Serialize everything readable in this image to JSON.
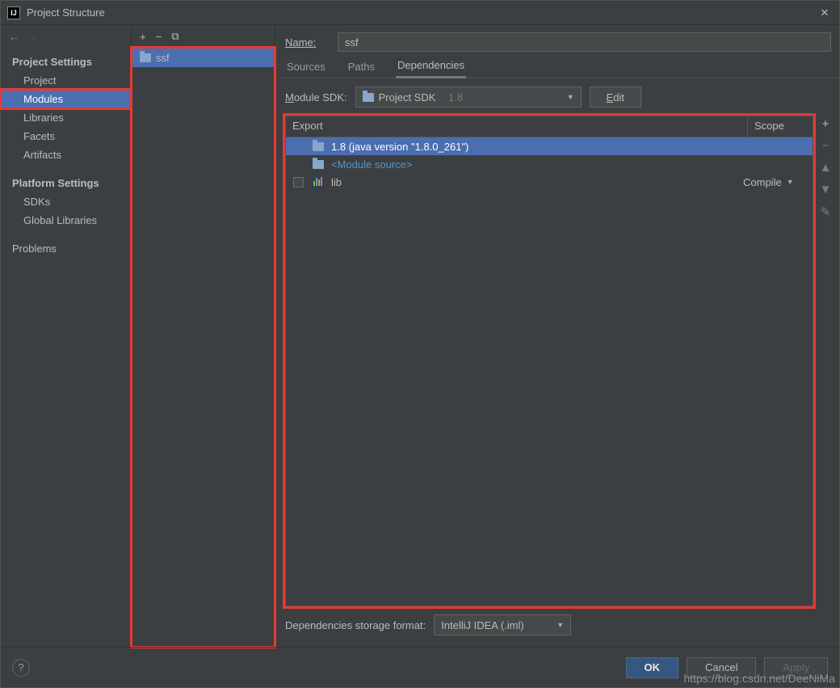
{
  "window": {
    "title": "Project Structure"
  },
  "sidebar": {
    "sections": [
      {
        "title": "Project Settings",
        "items": [
          "Project",
          "Modules",
          "Libraries",
          "Facets",
          "Artifacts"
        ],
        "selectedIndex": 1
      },
      {
        "title": "Platform Settings",
        "items": [
          "SDKs",
          "Global Libraries"
        ]
      },
      {
        "title": "",
        "items": [
          "Problems"
        ]
      }
    ]
  },
  "modulesList": {
    "items": [
      {
        "name": "ssf"
      }
    ],
    "selectedIndex": 0
  },
  "details": {
    "nameLabel": "Name:",
    "nameValue": "ssf",
    "tabs": [
      "Sources",
      "Paths",
      "Dependencies"
    ],
    "activeTab": 2,
    "sdkLabelPrefix": "M",
    "sdkLabelRest": "odule SDK:",
    "sdkCombo": {
      "text": "Project SDK",
      "suffix": "1.8"
    },
    "editPrefix": "E",
    "editRest": "dit",
    "depHeaders": {
      "export": "Export",
      "scope": "Scope"
    },
    "depRows": [
      {
        "icon": "folder",
        "text": "1.8 (java version \"1.8.0_261\")",
        "checkable": false,
        "scope": "",
        "selected": true
      },
      {
        "icon": "folder",
        "text": "<Module source>",
        "checkable": false,
        "link": true
      },
      {
        "icon": "lib",
        "text": "lib",
        "checkable": true,
        "scope": "Compile"
      }
    ],
    "formatLabel": "Dependencies storage format:",
    "formatValue": "IntelliJ IDEA (.iml)"
  },
  "footer": {
    "ok": "OK",
    "cancel": "Cancel",
    "apply": "Apply"
  },
  "watermark": "https://blog.csdn.net/DeeNiMa"
}
